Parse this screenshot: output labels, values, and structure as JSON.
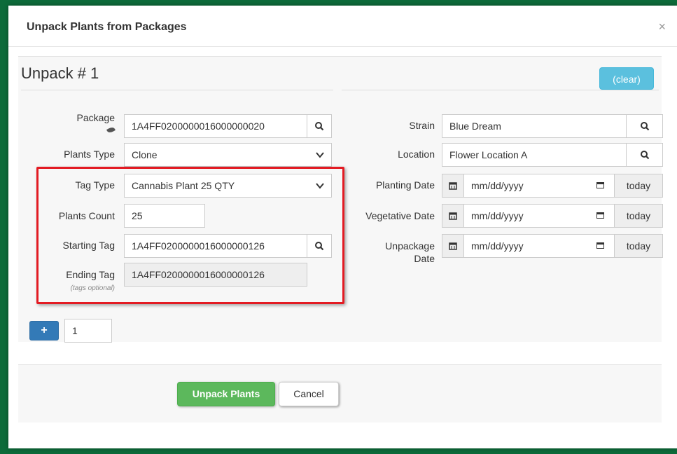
{
  "dialog": {
    "title": "Unpack Plants from Packages",
    "close_label": "×"
  },
  "unpack": {
    "heading": "Unpack # 1",
    "clear_label": "(clear)"
  },
  "left": {
    "package": {
      "label": "Package",
      "value": "1A4FF0200000016000000020"
    },
    "plants_type": {
      "label": "Plants Type",
      "value": "Clone"
    },
    "tag_type": {
      "label": "Tag Type",
      "value": "Cannabis Plant 25 QTY"
    },
    "plants_count": {
      "label": "Plants Count",
      "value": "25"
    },
    "starting_tag": {
      "label": "Starting Tag",
      "value": "1A4FF0200000016000000126"
    },
    "ending_tag": {
      "label": "Ending Tag",
      "value": "1A4FF0200000016000000126",
      "note": "(tags optional)"
    }
  },
  "right": {
    "strain": {
      "label": "Strain",
      "value": "Blue Dream"
    },
    "location": {
      "label": "Location",
      "value": "Flower Location A"
    },
    "planting_date": {
      "label": "Planting Date",
      "placeholder": "mm/dd/yyyy",
      "today": "today"
    },
    "vegetative_date": {
      "label": "Vegetative Date",
      "placeholder": "mm/dd/yyyy",
      "today": "today"
    },
    "unpackage_date": {
      "label_line1": "Unpackage",
      "label_line2": "Date",
      "placeholder": "mm/dd/yyyy",
      "today": "today"
    }
  },
  "add": {
    "plus_label": "+",
    "count_value": "1"
  },
  "footer": {
    "submit_label": "Unpack Plants",
    "cancel_label": "Cancel"
  },
  "colors": {
    "primary": "#337ab7",
    "info": "#5bc0de",
    "success": "#5cb85c",
    "highlight": "#e31b23",
    "frame": "#0d6b3a"
  }
}
